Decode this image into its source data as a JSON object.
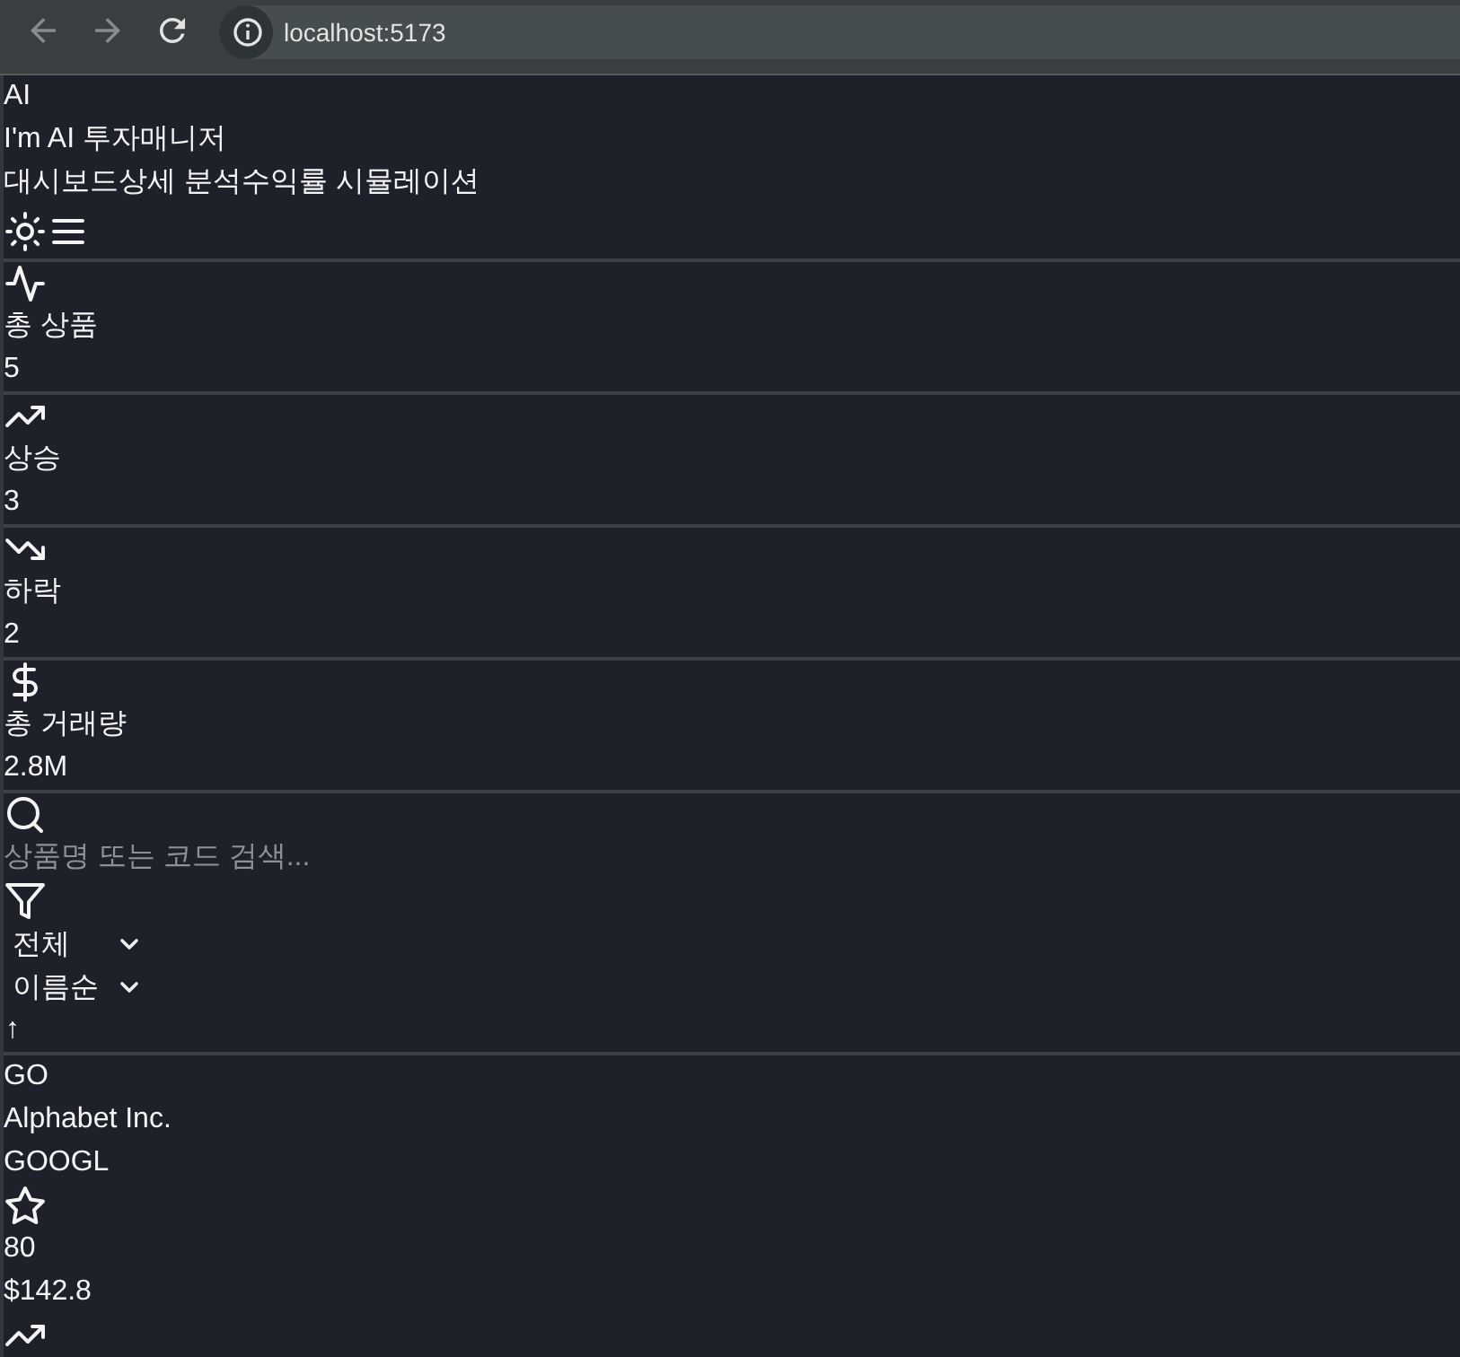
{
  "browser": {
    "nav_buttons": [
      {
        "kind": "back",
        "disabled": true
      },
      {
        "kind": "forward",
        "disabled": true
      },
      {
        "kind": "reload",
        "disabled": false
      }
    ],
    "url": "localhost:5173"
  },
  "header": {
    "logo": "AI",
    "title": "I'm AI 투자매니저",
    "nav": [
      {
        "label": "대시보드"
      },
      {
        "label": "상세 분석"
      },
      {
        "label": "수익률 시뮬레이션"
      }
    ]
  },
  "stats": [
    {
      "label": "총 상품",
      "value": "5"
    },
    {
      "label": "상승",
      "value": "3"
    },
    {
      "label": "하락",
      "value": "2"
    },
    {
      "label": "총 거래량",
      "value": "2.8M"
    }
  ],
  "filters": {
    "search": {
      "placeholder": "상품명 또는 코드 검색..."
    },
    "selects": [
      {
        "value": "전체"
      },
      {
        "value": "이름순"
      }
    ],
    "sort_order": "↑"
  },
  "products": [
    {
      "initials": "GO",
      "name": "Alphabet Inc.",
      "code": "GOOGL",
      "star_value": "80",
      "price": "$142.8",
      "rising": true
    }
  ]
}
